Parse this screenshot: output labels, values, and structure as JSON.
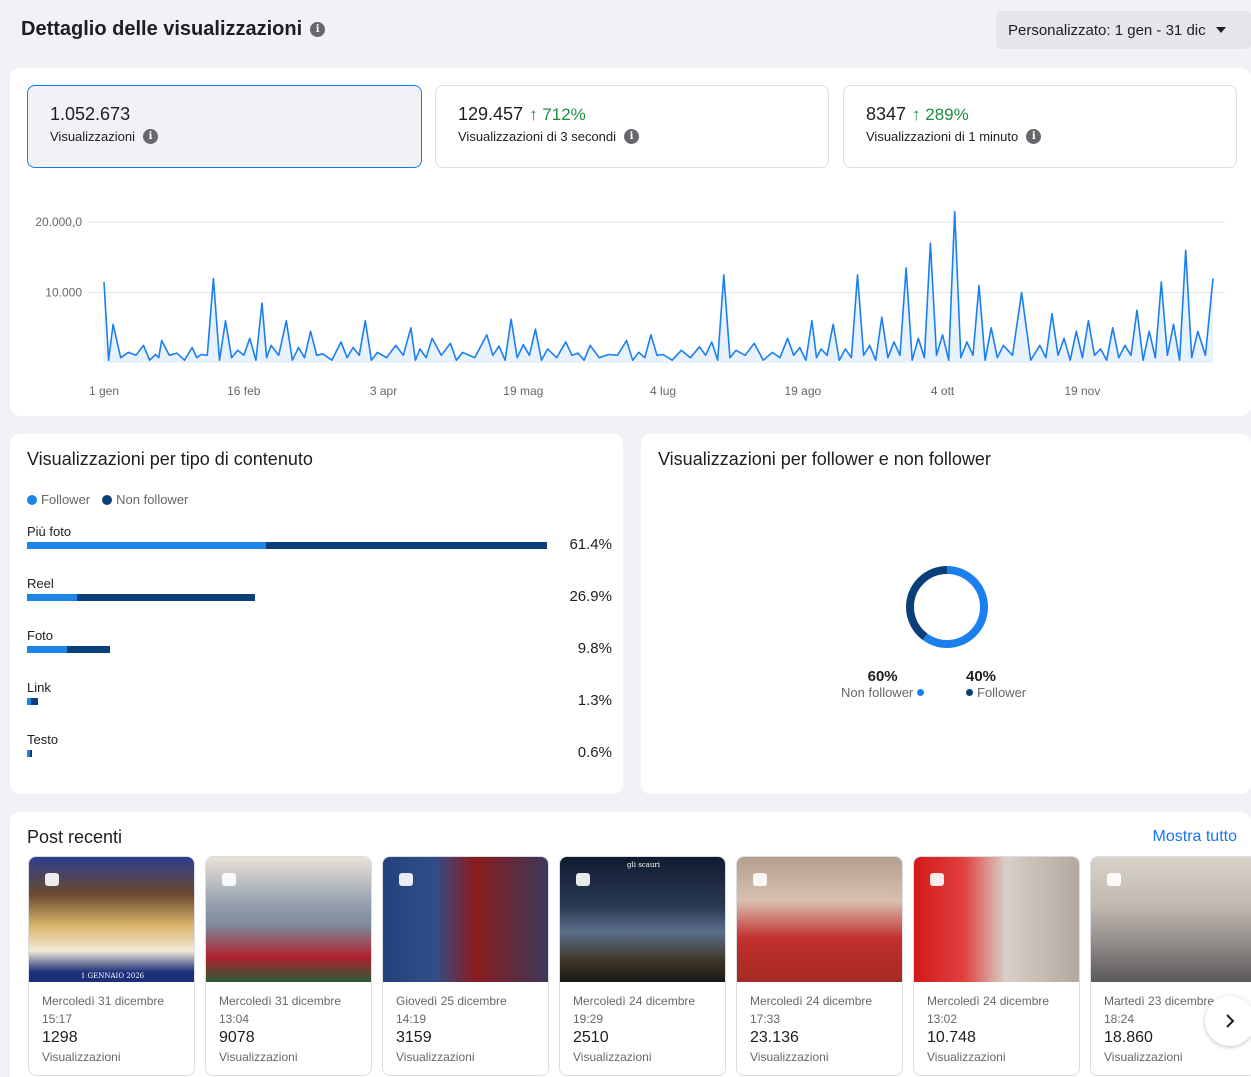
{
  "header": {
    "title": "Dettaglio delle visualizzazioni",
    "date_range": "Personalizzato: 1 gen - 31 dic"
  },
  "metrics": [
    {
      "value": "1.052.673",
      "delta": "",
      "label": "Visualizzazioni"
    },
    {
      "value": "129.457",
      "delta": "↑ 712%",
      "label": "Visualizzazioni di 3 secondi"
    },
    {
      "value": "8347",
      "delta": "↑ 289%",
      "label": "Visualizzazioni di 1 minuto"
    }
  ],
  "chart_data": [
    {
      "type": "area",
      "title": "",
      "ylim": [
        0,
        22000
      ],
      "yticks": [
        "10.000",
        "20.000,0"
      ],
      "ytick_values": [
        10000,
        20000
      ],
      "xticks": [
        "1 gen",
        "16 feb",
        "3 apr",
        "19 mag",
        "4 lug",
        "19 ago",
        "4 ott",
        "19 nov"
      ],
      "xtick_days": [
        0,
        46,
        92,
        138,
        184,
        230,
        276,
        322
      ],
      "color": "#1b7ff0",
      "x_unit": "day of year",
      "peaks": [
        [
          0,
          11500
        ],
        [
          3,
          5500
        ],
        [
          8,
          1500
        ],
        [
          13,
          2500
        ],
        [
          17,
          1200
        ],
        [
          19,
          3200
        ],
        [
          24,
          1400
        ],
        [
          29,
          2200
        ],
        [
          32,
          1200
        ],
        [
          36,
          12000
        ],
        [
          40,
          6000
        ],
        [
          44,
          1800
        ],
        [
          48,
          3500
        ],
        [
          52,
          8500
        ],
        [
          55,
          2500
        ],
        [
          60,
          6000
        ],
        [
          64,
          2200
        ],
        [
          68,
          4500
        ],
        [
          72,
          1300
        ],
        [
          78,
          3000
        ],
        [
          82,
          2200
        ],
        [
          86,
          6000
        ],
        [
          90,
          1500
        ],
        [
          96,
          2500
        ],
        [
          101,
          5000
        ],
        [
          104,
          2000
        ],
        [
          108,
          3500
        ],
        [
          114,
          2800
        ],
        [
          118,
          1500
        ],
        [
          126,
          4000
        ],
        [
          130,
          2400
        ],
        [
          134,
          6200
        ],
        [
          138,
          2600
        ],
        [
          142,
          4800
        ],
        [
          146,
          2000
        ],
        [
          152,
          3000
        ],
        [
          156,
          1400
        ],
        [
          160,
          2500
        ],
        [
          166,
          1200
        ],
        [
          172,
          3200
        ],
        [
          176,
          1500
        ],
        [
          180,
          4000
        ],
        [
          184,
          1200
        ],
        [
          190,
          1800
        ],
        [
          196,
          2300
        ],
        [
          200,
          3000
        ],
        [
          204,
          12500
        ],
        [
          208,
          1800
        ],
        [
          214,
          2800
        ],
        [
          220,
          1500
        ],
        [
          225,
          3500
        ],
        [
          229,
          2200
        ],
        [
          233,
          6000
        ],
        [
          236,
          2000
        ],
        [
          240,
          5500
        ],
        [
          244,
          2000
        ],
        [
          248,
          12500
        ],
        [
          252,
          2500
        ],
        [
          256,
          6500
        ],
        [
          260,
          3000
        ],
        [
          264,
          13500
        ],
        [
          268,
          3500
        ],
        [
          272,
          17000
        ],
        [
          276,
          4000
        ],
        [
          280,
          21500
        ],
        [
          284,
          3000
        ],
        [
          288,
          11000
        ],
        [
          292,
          5000
        ],
        [
          296,
          2500
        ],
        [
          302,
          10000
        ],
        [
          308,
          2500
        ],
        [
          312,
          7000
        ],
        [
          316,
          3500
        ],
        [
          320,
          4500
        ],
        [
          324,
          6000
        ],
        [
          328,
          2000
        ],
        [
          332,
          5000
        ],
        [
          336,
          2500
        ],
        [
          340,
          7500
        ],
        [
          344,
          4500
        ],
        [
          348,
          11500
        ],
        [
          352,
          5500
        ],
        [
          356,
          16000
        ],
        [
          360,
          4500
        ],
        [
          365,
          12000
        ]
      ]
    },
    {
      "type": "bar",
      "title": "Visualizzazioni per tipo di contenuto",
      "series_names": [
        "Follower",
        "Non follower"
      ],
      "rows": [
        {
          "label": "Più foto",
          "pct": "61.4%",
          "total": 61.4,
          "follower_share": 0.46
        },
        {
          "label": "Reel",
          "pct": "26.9%",
          "total": 26.9,
          "follower_share": 0.22
        },
        {
          "label": "Foto",
          "pct": "9.8%",
          "total": 9.8,
          "follower_share": 0.48
        },
        {
          "label": "Link",
          "pct": "1.3%",
          "total": 1.3,
          "follower_share": 0.4
        },
        {
          "label": "Testo",
          "pct": "0.6%",
          "total": 0.6,
          "follower_share": 0.5
        }
      ]
    },
    {
      "type": "pie",
      "title": "Visualizzazioni per follower e non follower",
      "slices": [
        {
          "name": "Non follower",
          "pct": "60%",
          "value": 60,
          "color": "#1b7ff0"
        },
        {
          "name": "Follower",
          "pct": "40%",
          "value": 40,
          "color": "#0a3f7a"
        }
      ]
    }
  ],
  "colors": {
    "follower": "#1b86e6",
    "non_follower": "#0a3f7a",
    "accent": "#1877f2",
    "positive": "#1e8e3e"
  },
  "legend": {
    "follower": "Follower",
    "non_follower": "Non follower"
  },
  "posts": {
    "title": "Post recenti",
    "show_all": "Mostra tutto",
    "items": [
      {
        "date": "Mercoledì 31 dicembre",
        "time": "15:17",
        "views": "1298",
        "caption": "Visualizzazioni",
        "type_icon": "photo-icon",
        "thumb_caption": "1 GENNAIO 2026"
      },
      {
        "date": "Mercoledì 31 dicembre",
        "time": "13:04",
        "views": "9078",
        "caption": "Visualizzazioni",
        "type_icon": "photo-icon"
      },
      {
        "date": "Giovedì 25 dicembre",
        "time": "14:19",
        "views": "3159",
        "caption": "Visualizzazioni",
        "type_icon": "reel-icon"
      },
      {
        "date": "Mercoledì 24 dicembre",
        "time": "19:29",
        "views": "2510",
        "caption": "Visualizzazioni",
        "type_icon": "photo-icon",
        "thumb_caption": "gli scauri"
      },
      {
        "date": "Mercoledì 24 dicembre",
        "time": "17:33",
        "views": "23.136",
        "caption": "Visualizzazioni",
        "type_icon": "reel-icon"
      },
      {
        "date": "Mercoledì 24 dicembre",
        "time": "13:02",
        "views": "10.748",
        "caption": "Visualizzazioni",
        "type_icon": "reel-icon"
      },
      {
        "date": "Martedì 23 dicembre",
        "time": "18:24",
        "views": "18.860",
        "caption": "Visualizzazioni",
        "type_icon": "reel-icon"
      }
    ]
  }
}
